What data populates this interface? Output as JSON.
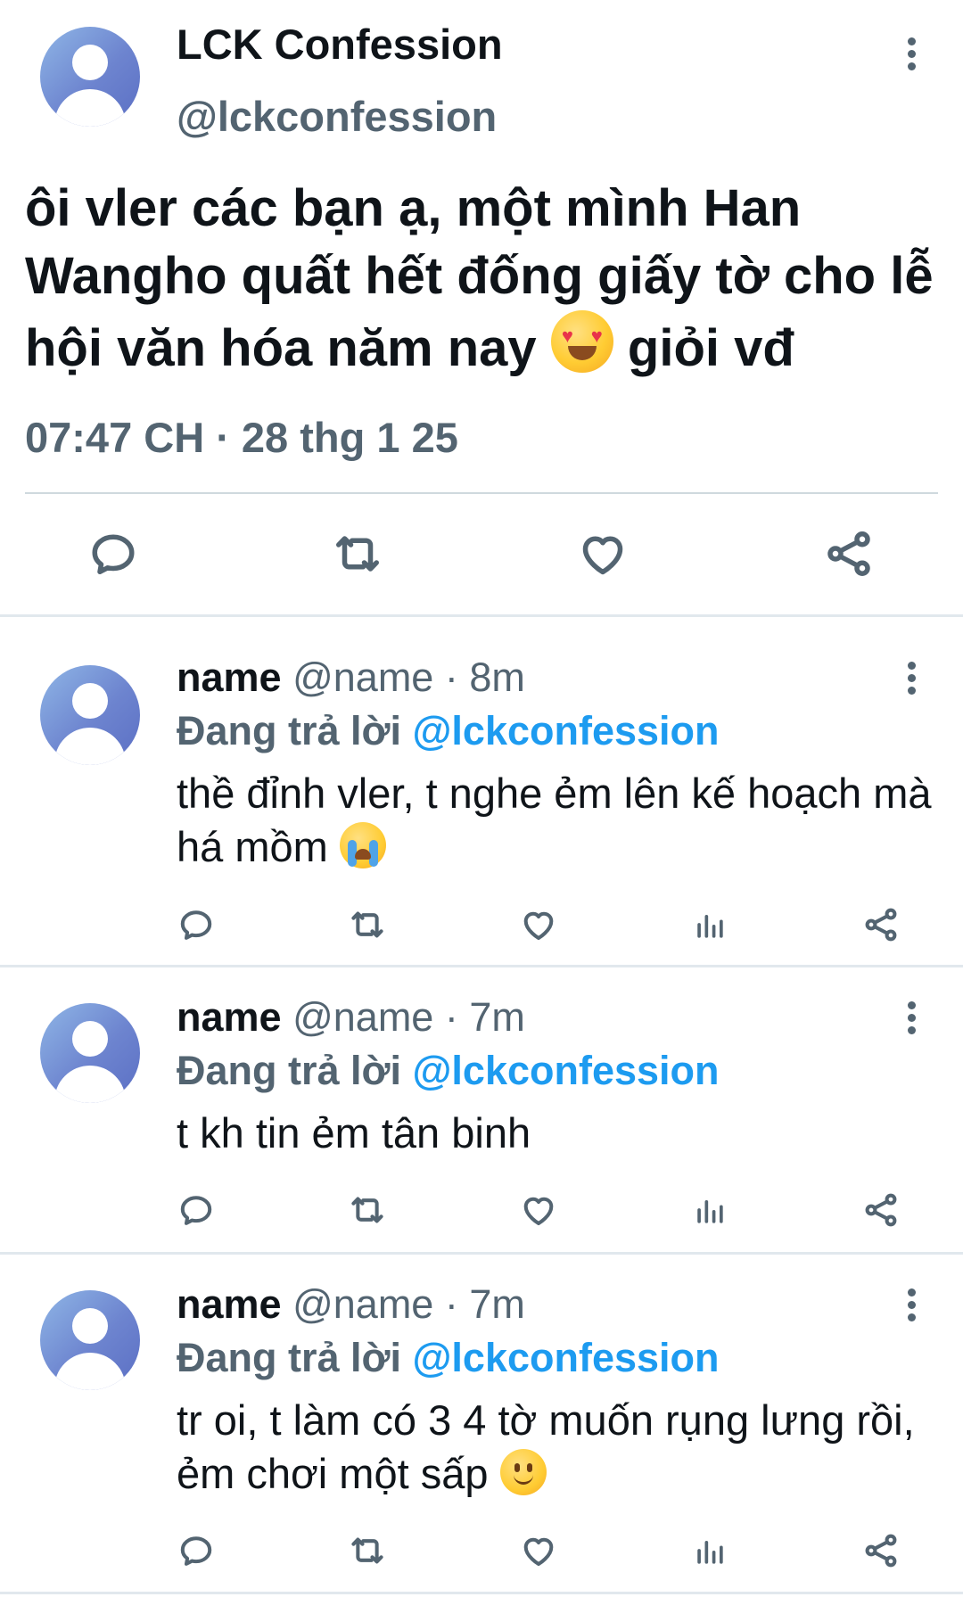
{
  "main_tweet": {
    "display_name": "LCK Confession",
    "handle": "@lckconfession",
    "text_before_emoji": "ôi vler các bạn ạ, một mình Han Wangho quất hết đống giấy tờ cho lễ hội văn hóa năm nay ",
    "emoji": "heart-eyes-emoji",
    "text_after_emoji": " giỏi vđ",
    "timestamp": "07:47 CH · 28 thg 1 25",
    "actions": [
      "reply-icon",
      "retweet-icon",
      "like-icon",
      "share-icon"
    ]
  },
  "replies": [
    {
      "name": "name",
      "handle": "@name",
      "time": " · 8m",
      "replying_prefix": "Đang trả lời ",
      "replying_to": "@lckconfession",
      "text": "thề đỉnh vler, t nghe ẻm lên kế hoạch mà há mồm ",
      "emoji": "loudly-crying-emoji"
    },
    {
      "name": "name",
      "handle": "@name",
      "time": " · 7m",
      "replying_prefix": "Đang trả lời ",
      "replying_to": "@lckconfession",
      "text": "t kh tin ẻm tân binh",
      "emoji": ""
    },
    {
      "name": "name",
      "handle": "@name",
      "time": " · 7m",
      "replying_prefix": "Đang trả lời ",
      "replying_to": "@lckconfession",
      "text": "tr oi, t làm có 3 4 tờ muốn rụng lưng rồi, ẻm chơi một sấp ",
      "emoji": "slightly-smiling-emoji"
    }
  ],
  "reply_actions": [
    "reply-icon",
    "retweet-icon",
    "like-icon",
    "views-icon",
    "share-icon"
  ],
  "colors": {
    "text_primary": "#0f1419",
    "text_secondary": "#536471",
    "mention_blue": "#1d9bf0",
    "divider": "#cfd9de"
  }
}
